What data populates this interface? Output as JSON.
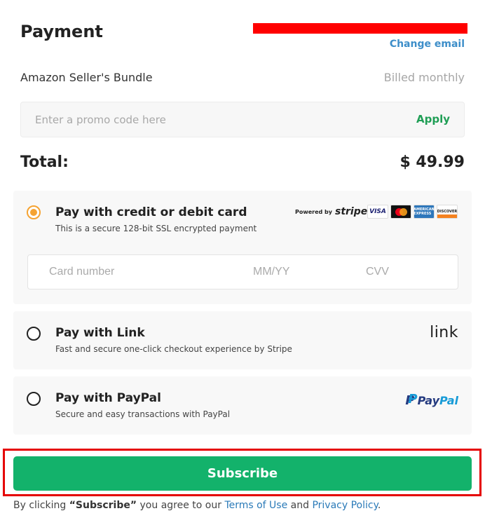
{
  "header": {
    "title": "Payment",
    "change_email_label": "Change email"
  },
  "order": {
    "product_name": "Amazon Seller's Bundle",
    "billing_period": "Billed monthly"
  },
  "promo": {
    "placeholder": "Enter a promo code here",
    "value": "",
    "apply_label": "Apply"
  },
  "total": {
    "label": "Total:",
    "value": "$ 49.99"
  },
  "payment_methods": [
    {
      "title": "Pay with credit or debit card",
      "subtitle": "This is a secure 128-bit SSL encrypted payment",
      "selected": true,
      "badge": {
        "powered_by": "Powered by",
        "brand": "stripe",
        "card_brands": [
          "visa-icon",
          "mastercard-icon",
          "amex-icon",
          "discover-icon"
        ],
        "visa_text": "VISA",
        "amex_text": "AMERICAN EXPRESS",
        "discover_text": "DISCOVER"
      },
      "fields": {
        "card_number_placeholder": "Card number",
        "expiry_placeholder": "MM/YY",
        "cvv_placeholder": "CVV"
      }
    },
    {
      "title": "Pay with Link",
      "subtitle": "Fast and secure one-click checkout experience by Stripe",
      "selected": false,
      "logo_text": "link"
    },
    {
      "title": "Pay with PayPal",
      "subtitle": "Secure and easy transactions with PayPal",
      "selected": false,
      "logo_pay": "Pay",
      "logo_pal": "Pal",
      "logo_icon": "P"
    }
  ],
  "subscribe": {
    "label": "Subscribe"
  },
  "terms": {
    "prefix": "By clicking",
    "button_ref": "“Subscribe”",
    "middle": "you agree to our",
    "terms_link": "Terms of Use",
    "and": "and",
    "privacy_link": "Privacy Policy",
    "suffix": "."
  },
  "colors": {
    "accent_green": "#13b26b",
    "apply_green": "#1f9e55",
    "link_blue": "#3d8ec9",
    "radio_selected": "#f5a332",
    "highlight_red": "#e50000",
    "redaction_red": "#ff0000"
  }
}
